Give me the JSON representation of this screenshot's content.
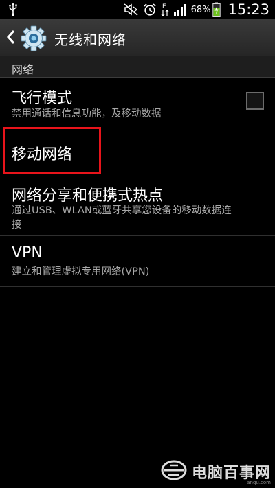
{
  "status_bar": {
    "battery_percent": "68%",
    "time": "15:23"
  },
  "action_bar": {
    "title": "无线和网络"
  },
  "section": {
    "header": "网络"
  },
  "items": [
    {
      "title": "飞行模式",
      "subtitle": "禁用通话和信息功能，及移动数据",
      "checked": false
    },
    {
      "title": "移动网络"
    },
    {
      "title": "网络分享和便携式热点",
      "subtitle_line1": "通过USB、WLAN或蓝牙共享您设备的移动数据连",
      "subtitle_line2": "接"
    },
    {
      "title": "VPN",
      "subtitle": "建立和管理虚拟专用网络(VPN)"
    }
  ],
  "watermark": {
    "text": "电脑百事网",
    "domain": "anqu.com"
  },
  "colors": {
    "highlight": "#e8141b",
    "battery": "#6cc21a",
    "accent_gear": "#8fd0f0"
  }
}
